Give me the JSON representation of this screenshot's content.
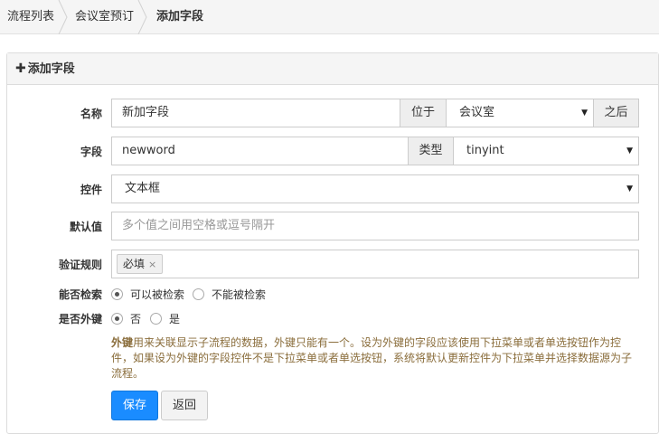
{
  "breadcrumb": {
    "items": [
      "流程列表",
      "会议室预订",
      "添加字段"
    ]
  },
  "panel": {
    "title": "添加字段"
  },
  "form": {
    "name": {
      "label": "名称",
      "value": "新加字段",
      "position_addon": "位于",
      "position_value": "会议室",
      "after_addon": "之后"
    },
    "field": {
      "label": "字段",
      "value": "newword",
      "type_addon": "类型",
      "type_value": "tinyint"
    },
    "control": {
      "label": "控件",
      "value": "文本框"
    },
    "default": {
      "label": "默认值",
      "placeholder": "多个值之间用空格或逗号隔开"
    },
    "validation": {
      "label": "验证规则",
      "tag": "必填",
      "tag_remove": "×"
    },
    "searchable": {
      "label": "能否检索",
      "options": [
        "可以被检索",
        "不能被检索"
      ],
      "selected": 0
    },
    "foreign_key": {
      "label": "是否外键",
      "options": [
        "否",
        "是"
      ],
      "selected": 0
    },
    "help": {
      "bold": "外键",
      "text": "用来关联显示子流程的数据，外键只能有一个。设为外键的字段应该使用下拉菜单或者单选按钮作为控件，如果设为外键的字段控件不是下拉菜单或者单选按钮，系统将默认更新控件为下拉菜单并选择数据源为子流程。"
    },
    "buttons": {
      "save": "保存",
      "back": "返回"
    }
  },
  "colors": {
    "primary": "#1a8cff",
    "help_text": "#8a6d3b",
    "breadcrumb_bg": "#f5f5f5"
  }
}
